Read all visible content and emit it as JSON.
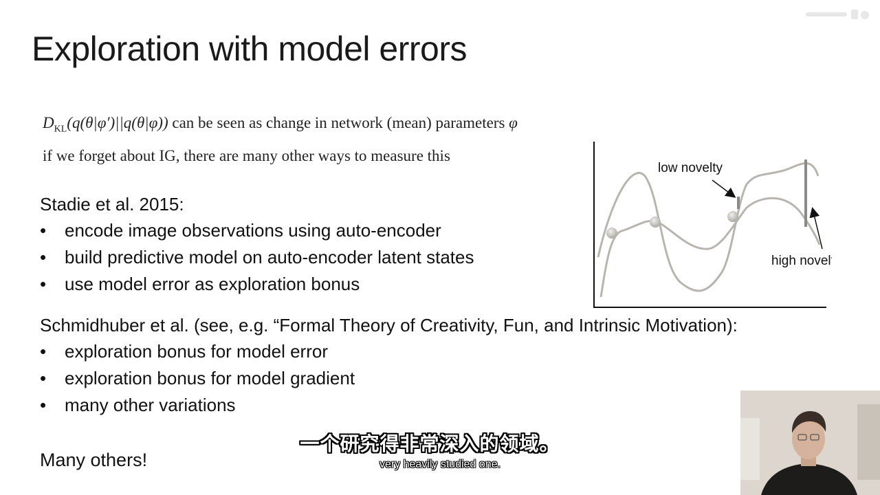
{
  "slide": {
    "title": "Exploration with model errors",
    "math_line2": "if we forget about IG, there are many other ways to measure this",
    "stadie": {
      "heading": "Stadie et al. 2015:",
      "bullets": [
        "encode image observations using auto-encoder",
        "build predictive model on auto-encoder latent states",
        "use model error as exploration bonus"
      ]
    },
    "schmidhuber": {
      "heading": "Schmidhuber et al. (see, e.g. “Formal Theory of Creativity, Fun, and Intrinsic Motivation):",
      "bullets": [
        "exploration bonus for model error",
        "exploration bonus for model gradient",
        "many other variations"
      ]
    },
    "closing": "Many others!"
  },
  "math": {
    "dkl_label": "D",
    "dkl_sub": "KL",
    "dkl_args": "(q(θ|φ′)||q(θ|φ))",
    "dkl_text": " can be seen as change in network (mean) parameters ",
    "phi": "φ"
  },
  "figure": {
    "low_label": "low novelty",
    "high_label": "high novelty",
    "curve_color": "#b8b5b0",
    "arrow_color": "#8a8a8a"
  },
  "subtitles": {
    "chinese": "一个研究得非常深入的领域。",
    "english": "very heavily studied one."
  }
}
